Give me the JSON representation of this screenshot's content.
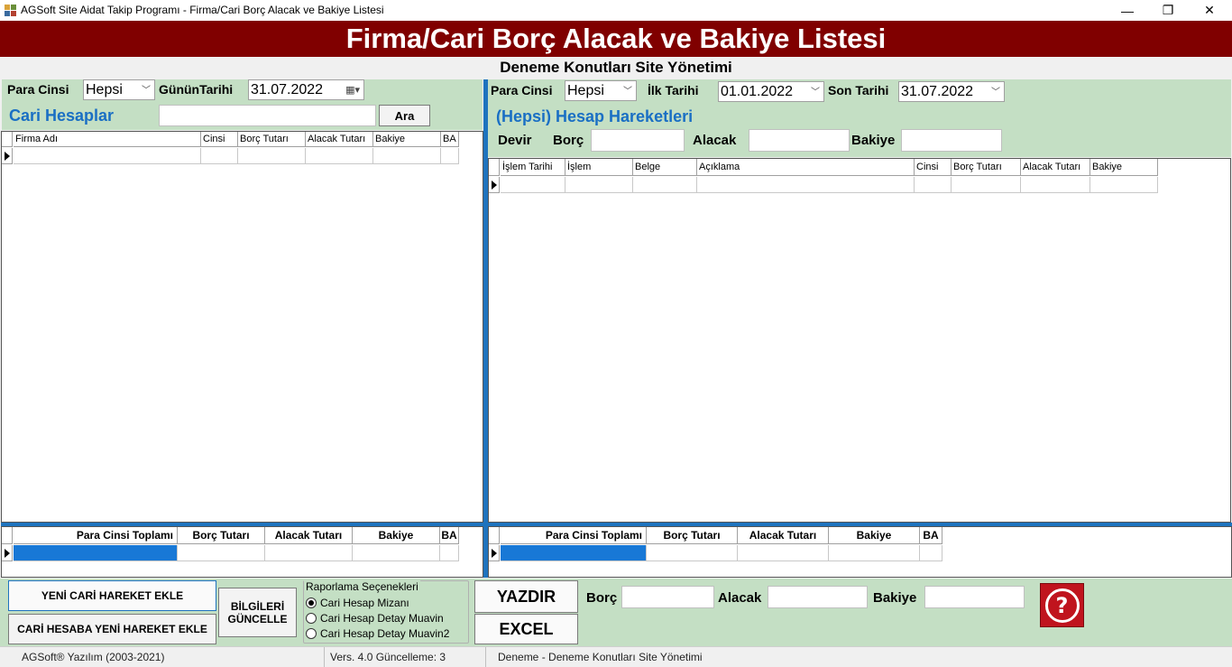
{
  "window": {
    "title": "AGSoft Site Aidat Takip Programı - Firma/Cari Borç Alacak ve Bakiye Listesi",
    "minimize": "—",
    "maximize": "❐",
    "close": "✕"
  },
  "banner": {
    "title": "Firma/Cari Borç Alacak ve Bakiye Listesi"
  },
  "subtitle": "Deneme Konutları Site Yönetimi",
  "left": {
    "para_cinsi_label": "Para Cinsi",
    "para_cinsi_value": "Hepsi",
    "gunun_tarihi_label": "GününTarihi",
    "gunun_tarihi_value": "31.07.2022",
    "cari_hesaplar_label": "Cari Hesaplar",
    "search_value": "",
    "ara_button": "Ara",
    "grid_columns": [
      "Firma Adı",
      "Cinsi",
      "Borç Tutarı",
      "Alacak Tutarı",
      "Bakiye",
      "BA"
    ],
    "summary_columns": [
      "Para Cinsi Toplamı",
      "Borç Tutarı",
      "Alacak Tutarı",
      "Bakiye",
      "BA"
    ]
  },
  "right": {
    "para_cinsi_label": "Para Cinsi",
    "para_cinsi_value": "Hepsi",
    "ilk_tarihi_label": "İlk Tarihi",
    "ilk_tarihi_value": "01.01.2022",
    "son_tarihi_label": "Son Tarihi",
    "son_tarihi_value": "31.07.2022",
    "hareketler_label": "(Hepsi) Hesap Hareketleri",
    "devir_label": "Devir",
    "borc_label": "Borç",
    "alacak_label": "Alacak",
    "bakiye_label": "Bakiye",
    "grid_columns": [
      "İşlem Tarihi",
      "İşlem",
      "Belge",
      "Açıklama",
      "Cinsi",
      "Borç Tutarı",
      "Alacak Tutarı",
      "Bakiye"
    ],
    "summary_columns": [
      "Para Cinsi Toplamı",
      "Borç Tutarı",
      "Alacak Tutarı",
      "Bakiye",
      "BA"
    ]
  },
  "bottom": {
    "yeni_cari_button": "YENİ CARİ HAREKET EKLE",
    "cari_hesaba_button": "CARİ HESABA YENİ HAREKET EKLE",
    "bilgileri_guncelle_line1": "BİLGİLERİ",
    "bilgileri_guncelle_line2": "GÜNCELLE",
    "raporlama_label": "Raporlama Seçenekleri",
    "radio_options": [
      "Cari Hesap Mizanı",
      "Cari Hesap Detay Muavin",
      "Cari Hesap Detay Muavin2"
    ],
    "selected_radio": 0,
    "yazdir_button": "YAZDIR",
    "excel_button": "EXCEL",
    "borc_label": "Borç",
    "alacak_label": "Alacak",
    "bakiye_label": "Bakiye",
    "help_icon": "?"
  },
  "status": {
    "copyright": "AGSoft® Yazılım (2003-2021)",
    "version": "Vers. 4.0 Güncelleme: 3",
    "site": "Deneme - Deneme Konutları Site Yönetimi"
  },
  "colors": {
    "banner": "#800000",
    "panel_green": "#c4dfc4",
    "accent_blue": "#1a6fc4",
    "divider_blue": "#1e73be",
    "help_red": "#c0141e"
  }
}
